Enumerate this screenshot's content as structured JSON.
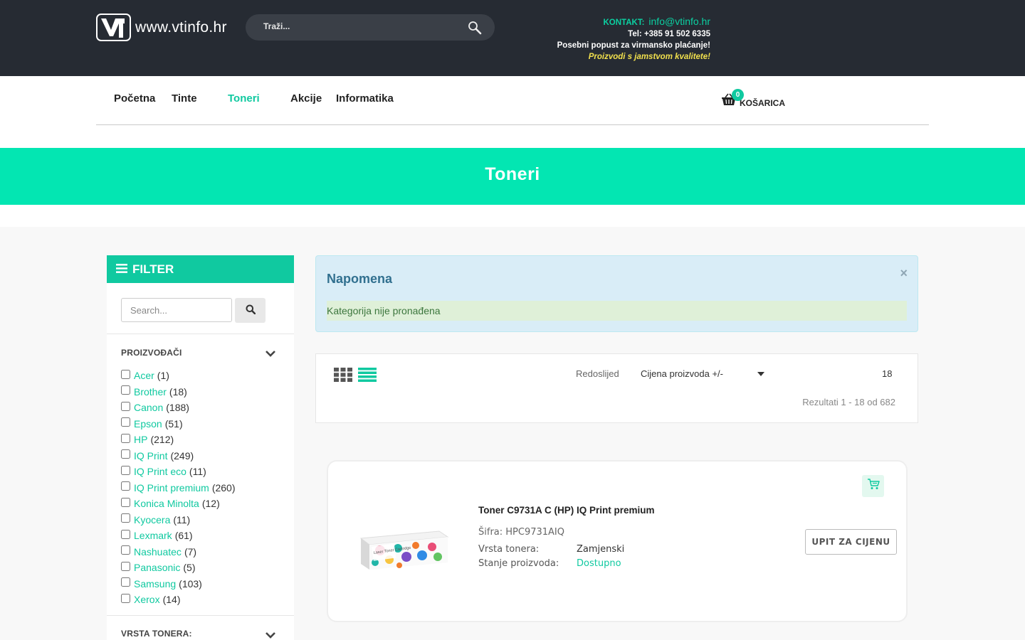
{
  "header": {
    "logo_text": "www.vtinfo.hr",
    "search_placeholder": "Traži...",
    "contact_label": "KONTAKT:",
    "contact_email": "info@vtinfo.hr",
    "phone": "Tel: +385 91 502 6335",
    "discount": "Posebni popust za virmansko plaćanje!",
    "quality": "Proizvodi s jamstvom kvalitete!"
  },
  "nav": {
    "items": [
      {
        "label": "Početna",
        "active": false
      },
      {
        "label": "Tinte",
        "active": false
      },
      {
        "label": "Toneri",
        "active": true
      },
      {
        "label": "Akcije",
        "active": false
      },
      {
        "label": "Informatika",
        "active": false
      }
    ],
    "cart_count": "0",
    "cart_label": "KOŠARICA"
  },
  "banner": {
    "title": "Toneri"
  },
  "filter": {
    "title": "FILTER",
    "search_placeholder": "Search...",
    "manufacturers_title": "PROIZVOĐAČI",
    "manufacturers": [
      {
        "name": "Acer",
        "count": "(1)"
      },
      {
        "name": "Brother",
        "count": "(18)"
      },
      {
        "name": "Canon",
        "count": "(188)"
      },
      {
        "name": "Epson",
        "count": "(51)"
      },
      {
        "name": "HP",
        "count": "(212)"
      },
      {
        "name": "IQ Print",
        "count": "(249)"
      },
      {
        "name": "IQ Print eco",
        "count": "(11)"
      },
      {
        "name": "IQ Print premium",
        "count": "(260)"
      },
      {
        "name": "Konica Minolta",
        "count": "(12)"
      },
      {
        "name": "Kyocera",
        "count": "(11)"
      },
      {
        "name": "Lexmark",
        "count": "(61)"
      },
      {
        "name": "Nashuatec",
        "count": "(7)"
      },
      {
        "name": "Panasonic",
        "count": "(5)"
      },
      {
        "name": "Samsung",
        "count": "(103)"
      },
      {
        "name": "Xerox",
        "count": "(14)"
      }
    ],
    "toner_type_title": "VRSTA TONERA:"
  },
  "notice": {
    "title": "Napomena",
    "close": "×",
    "message": "Kategorija nije pronađena"
  },
  "toolbar": {
    "sort_label": "Redoslijed",
    "sort_value": "Cijena proizvoda +/-",
    "per_page": "18",
    "results": "Rezultati 1 - 18 od 682"
  },
  "product": {
    "title": "Toner C9731A C (HP) IQ Print premium",
    "code": "Šifra: HPC9731AIQ",
    "type_label": "Vrsta tonera:",
    "type_value": "Zamjenski",
    "stock_label": "Stanje proizvoda:",
    "stock_value": "Dostupno",
    "price_button": "UPIT ZA CIJENU",
    "box_text": "Laser Toner Cartridge"
  },
  "colors": {
    "accent": "#10c9a0",
    "banner": "#03e6b2",
    "header_bg": "#262b33",
    "promo": "#f1e04d"
  }
}
